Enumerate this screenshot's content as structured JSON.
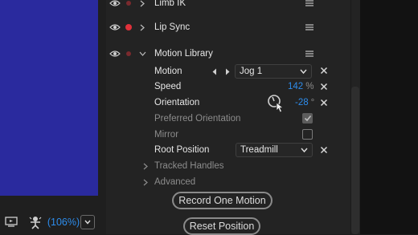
{
  "puppet_panel": {
    "rows": [
      {
        "label": "Limb IK"
      },
      {
        "label": "Lip Sync"
      },
      {
        "label": "Motion Library"
      }
    ]
  },
  "motion_library": {
    "motion": {
      "label": "Motion",
      "value": "Jog 1"
    },
    "speed": {
      "label": "Speed",
      "value": "142",
      "unit": "%"
    },
    "orientation": {
      "label": "Orientation",
      "value": "-28",
      "unit": "°"
    },
    "preferred_orientation": {
      "label": "Preferred Orientation",
      "checked": true
    },
    "mirror": {
      "label": "Mirror",
      "checked": false
    },
    "root_position": {
      "label": "Root Position",
      "value": "Treadmill"
    },
    "tracked_handles": {
      "label": "Tracked Handles"
    },
    "advanced": {
      "label": "Advanced"
    },
    "record_button": "Record One Motion",
    "reset_button": "Reset Position"
  },
  "toolbar": {
    "zoom": "(106%)"
  },
  "colors": {
    "accent_blue": "#2d8ceb",
    "record_red": "#e0313a",
    "canvas_blue": "#2a2a9e"
  }
}
